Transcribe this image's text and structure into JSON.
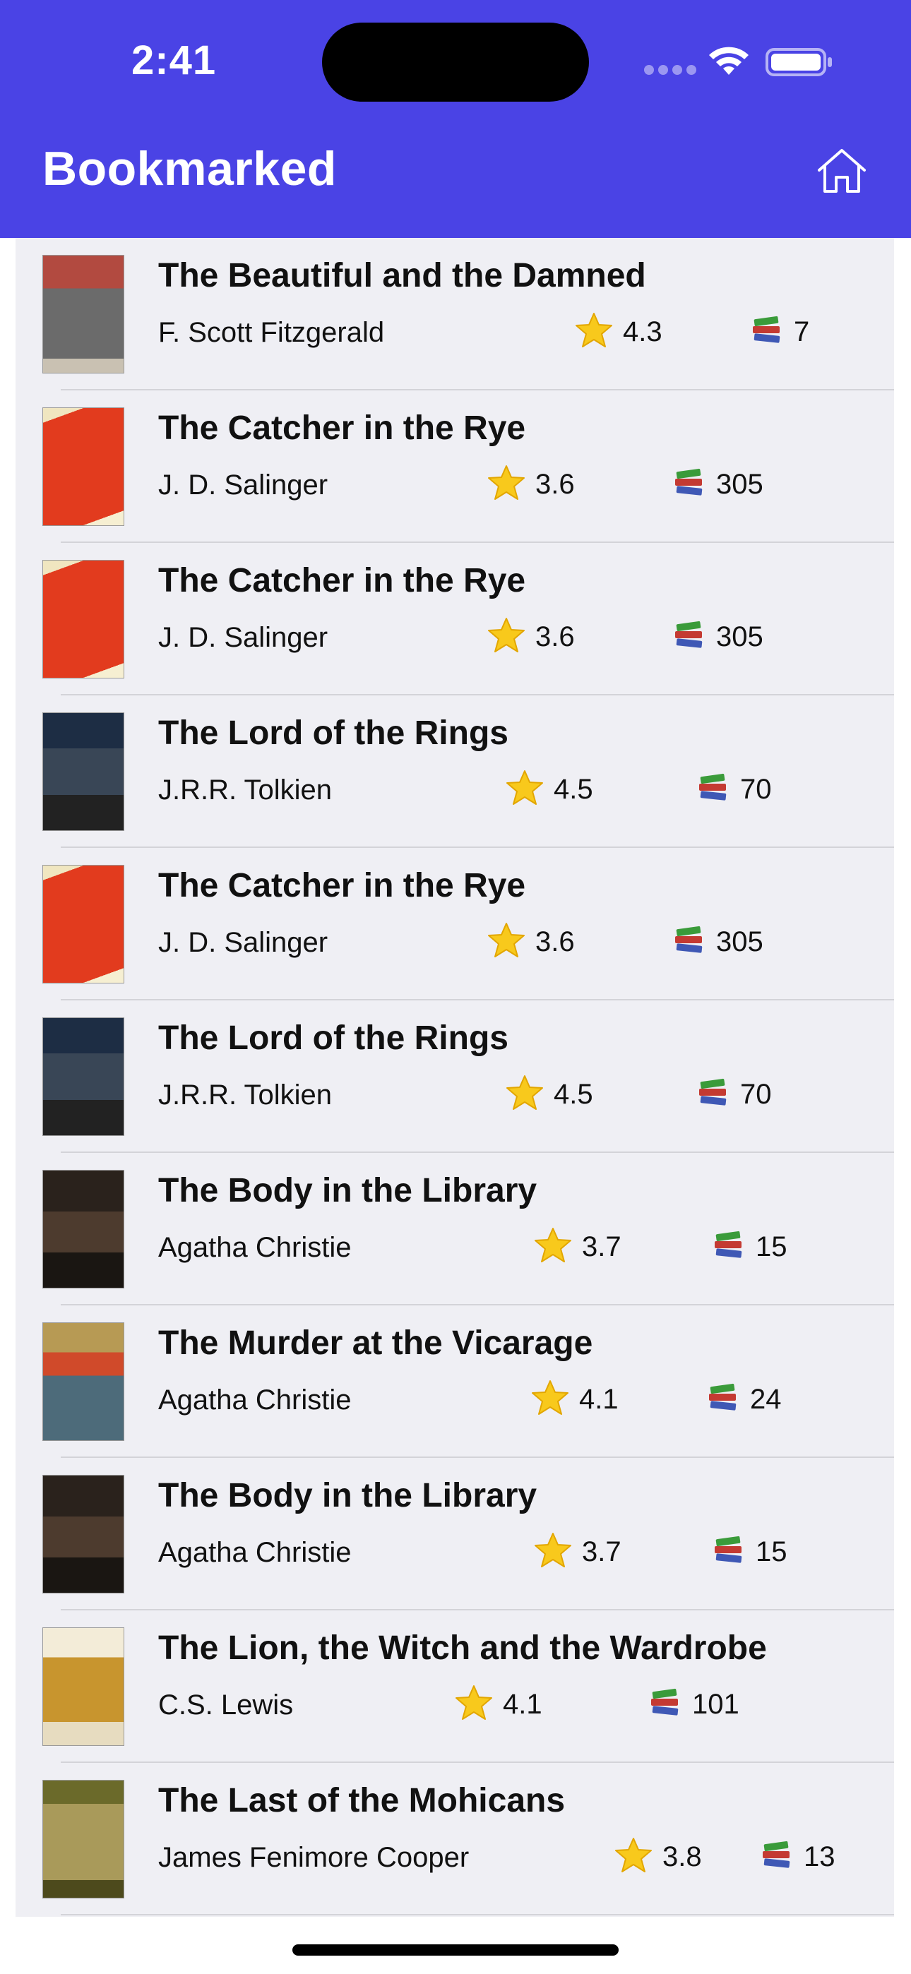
{
  "status_bar": {
    "time": "2:41"
  },
  "header": {
    "title": "Bookmarked",
    "home_icon": "house-icon"
  },
  "colors": {
    "header": "#4a43e5",
    "list_bg": "#efeff4",
    "star": "#f5c518"
  },
  "books": [
    {
      "title": "The Beautiful and the Damned",
      "author": "F. Scott Fitzgerald",
      "rating": "4.3",
      "count": "7"
    },
    {
      "title": "The Catcher in the Rye",
      "author": "J. D. Salinger",
      "rating": "3.6",
      "count": "305"
    },
    {
      "title": "The Catcher in the Rye",
      "author": "J. D. Salinger",
      "rating": "3.6",
      "count": "305"
    },
    {
      "title": "The Lord of the Rings",
      "author": "J.R.R. Tolkien",
      "rating": "4.5",
      "count": "70"
    },
    {
      "title": "The Catcher in the Rye",
      "author": "J. D. Salinger",
      "rating": "3.6",
      "count": "305"
    },
    {
      "title": "The Lord of the Rings",
      "author": "J.R.R. Tolkien",
      "rating": "4.5",
      "count": "70"
    },
    {
      "title": "The Body in the Library",
      "author": "Agatha Christie",
      "rating": "3.7",
      "count": "15"
    },
    {
      "title": "The Murder at the Vicarage",
      "author": "Agatha Christie",
      "rating": "4.1",
      "count": "24"
    },
    {
      "title": "The Body in the Library",
      "author": "Agatha Christie",
      "rating": "3.7",
      "count": "15"
    },
    {
      "title": "The Lion, the Witch and the Wardrobe",
      "author": "C.S. Lewis",
      "rating": "4.1",
      "count": "101"
    },
    {
      "title": "The Last of the Mohicans",
      "author": "James Fenimore Cooper",
      "rating": "3.8",
      "count": "13"
    }
  ]
}
